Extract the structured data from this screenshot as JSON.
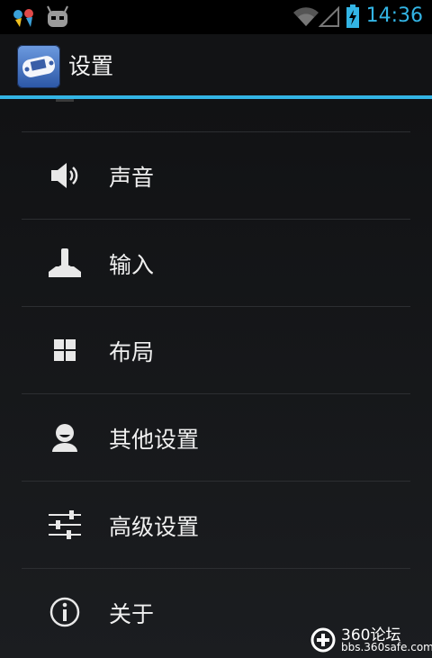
{
  "status_bar": {
    "time": "14:36",
    "icons": [
      "notification-app-icon",
      "android-robot-icon",
      "wifi-icon",
      "signal-icon",
      "battery-charging-icon"
    ]
  },
  "action_bar": {
    "title": "设置",
    "app_icon": "gba-emulator-app-icon"
  },
  "settings": {
    "items": [
      {
        "label": "声音",
        "icon": "speaker-icon"
      },
      {
        "label": "输入",
        "icon": "joystick-icon"
      },
      {
        "label": "布局",
        "icon": "grid-icon"
      },
      {
        "label": "其他设置",
        "icon": "person-icon"
      },
      {
        "label": "高级设置",
        "icon": "sliders-icon"
      },
      {
        "label": "关于",
        "icon": "info-icon"
      }
    ]
  },
  "watermark": {
    "brand": "360论坛",
    "url": "bbs.360safe.com"
  },
  "colors": {
    "accent": "#33b5e5",
    "background": "#111214",
    "divider": "#2c2e31"
  }
}
